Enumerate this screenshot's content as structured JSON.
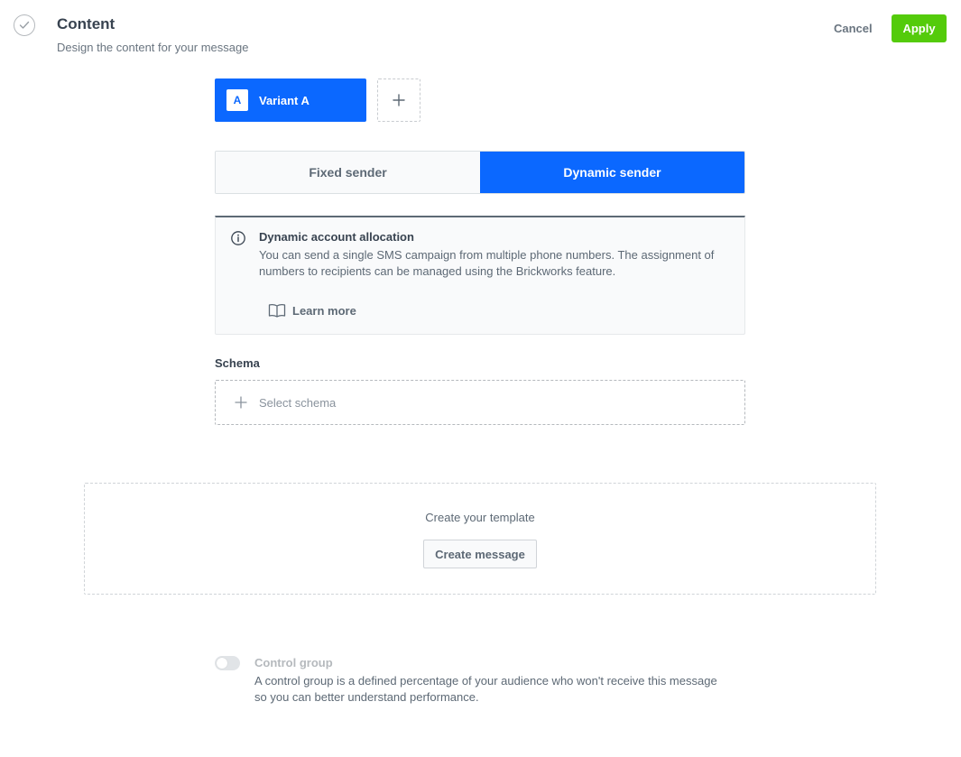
{
  "header": {
    "title": "Content",
    "subtitle": "Design the content for your message",
    "cancel_label": "Cancel",
    "apply_label": "Apply"
  },
  "variants": {
    "items": [
      {
        "badge": "A",
        "label": "Variant A"
      }
    ],
    "add_icon": "plus-icon"
  },
  "sender": {
    "options": [
      "Fixed sender",
      "Dynamic sender"
    ],
    "selected": "Dynamic sender"
  },
  "info": {
    "icon": "info-icon",
    "title": "Dynamic account allocation",
    "text": "You can send a single SMS campaign from multiple phone numbers. The assignment of numbers to recipients can be managed using the Brickworks feature.",
    "link_icon": "book-icon",
    "link_label": "Learn more"
  },
  "schema": {
    "label": "Schema",
    "placeholder": "Select schema"
  },
  "template": {
    "title": "Create your template",
    "button_label": "Create message"
  },
  "control_group": {
    "title": "Control group",
    "description": "A control group is a defined percentage of your audience who won't receive this message so you can better understand performance.",
    "enabled": false
  },
  "colors": {
    "primary": "#0b68ff",
    "apply": "#54cb0b",
    "text": "#384350",
    "muted": "#5d6975"
  }
}
